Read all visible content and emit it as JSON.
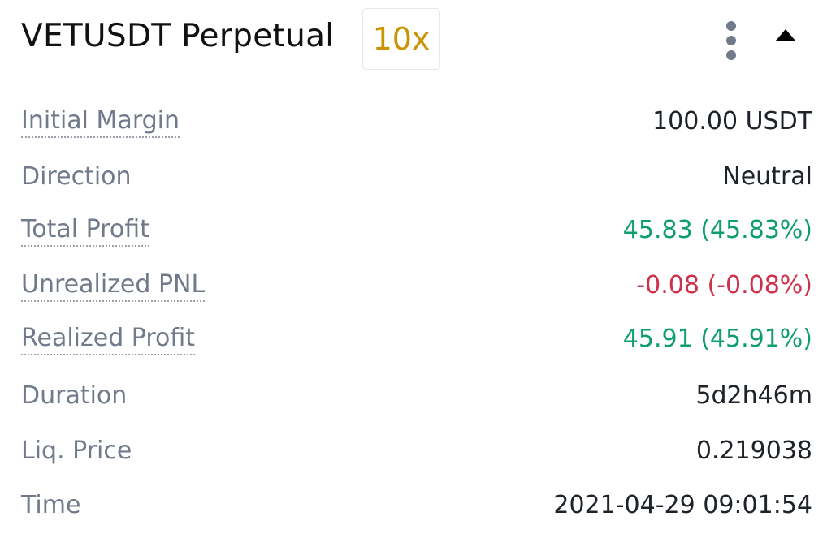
{
  "header": {
    "title": "VETUSDT Perpetual",
    "leverage": "10x",
    "more_icon": "more-vertical-icon",
    "collapse_icon": "caret-up-icon"
  },
  "colors": {
    "leverage": "#c99400",
    "positive": "#0e9e6e",
    "negative": "#cf304a",
    "label": "#707a8a",
    "value": "#1e2329"
  },
  "rows": [
    {
      "label": "Initial Margin",
      "value": "100.00 USDT",
      "tone": "neutral",
      "tooltip": true
    },
    {
      "label": "Direction",
      "value": "Neutral",
      "tone": "neutral",
      "tooltip": false
    },
    {
      "label": "Total Profit",
      "value": "45.83 (45.83%)",
      "tone": "positive",
      "tooltip": true
    },
    {
      "label": "Unrealized PNL",
      "value": "-0.08 (-0.08%)",
      "tone": "negative",
      "tooltip": true
    },
    {
      "label": "Realized Profit",
      "value": "45.91 (45.91%)",
      "tone": "positive",
      "tooltip": true
    },
    {
      "label": "Duration",
      "value": "5d2h46m",
      "tone": "neutral",
      "tooltip": false
    },
    {
      "label": "Liq. Price",
      "value": "0.219038",
      "tone": "neutral",
      "tooltip": false
    },
    {
      "label": "Time",
      "value": "2021-04-29 09:01:54",
      "tone": "neutral",
      "tooltip": false
    }
  ]
}
